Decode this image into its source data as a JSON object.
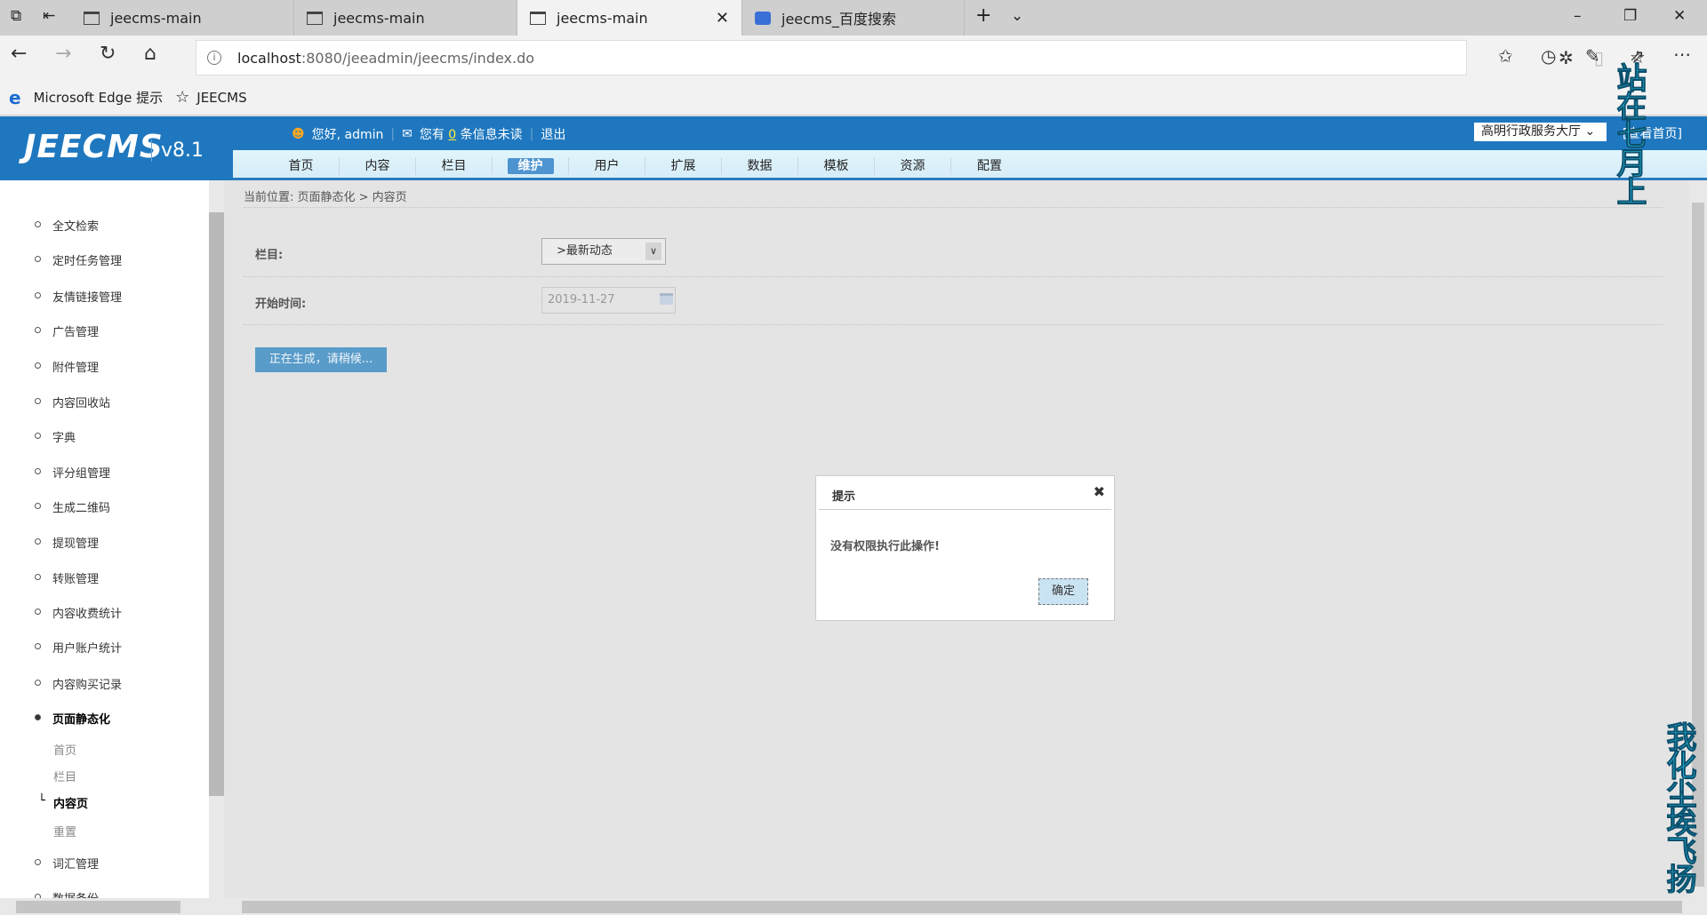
{
  "browser": {
    "tabs": [
      {
        "label": "jeecms-main"
      },
      {
        "label": "jeecms-main"
      },
      {
        "label": "jeecms-main",
        "active": true
      },
      {
        "label": "jeecms_百度搜索"
      }
    ],
    "url_host": "localhost",
    "url_rest": ":8080/jeeadmin/jeecms/index.do",
    "favorites": [
      {
        "label": "Microsoft Edge 提示"
      },
      {
        "label": "JEECMS"
      }
    ]
  },
  "header": {
    "logo": "JEECMS",
    "version": "v8.1",
    "greeting": "您好, admin",
    "msg_prefix": "您有",
    "msg_count": "0",
    "msg_suffix": "条信息未读",
    "logout": "退出",
    "site_select": "高明行政服务大厅",
    "view_home": "[查看首页]",
    "nav": [
      "首页",
      "内容",
      "栏目",
      "维护",
      "用户",
      "扩展",
      "数据",
      "模板",
      "资源",
      "配置"
    ],
    "nav_active": "维护"
  },
  "sidebar": {
    "items": [
      "全文检索",
      "定时任务管理",
      "友情链接管理",
      "广告管理",
      "附件管理",
      "内容回收站",
      "字典",
      "评分组管理",
      "生成二维码",
      "提现管理",
      "转账管理",
      "内容收费统计",
      "用户账户统计",
      "内容购买记录",
      "页面静态化"
    ],
    "subitems": [
      "首页",
      "栏目",
      "内容页",
      "重置"
    ],
    "after": [
      "词汇管理",
      "数据备份"
    ]
  },
  "main": {
    "breadcrumb": "当前位置: 页面静态化 > 内容页",
    "channel_label": "栏目:",
    "channel_value": ">最新动态",
    "start_label": "开始时间:",
    "start_value": "2019-11-27",
    "generate_button": "正在生成，请稍候..."
  },
  "dialog": {
    "title": "提示",
    "message": "没有权限执行此操作!",
    "ok": "确定"
  },
  "overlay": {
    "lyric1": "站在七月上",
    "lyric2": "我化尘埃飞扬"
  }
}
